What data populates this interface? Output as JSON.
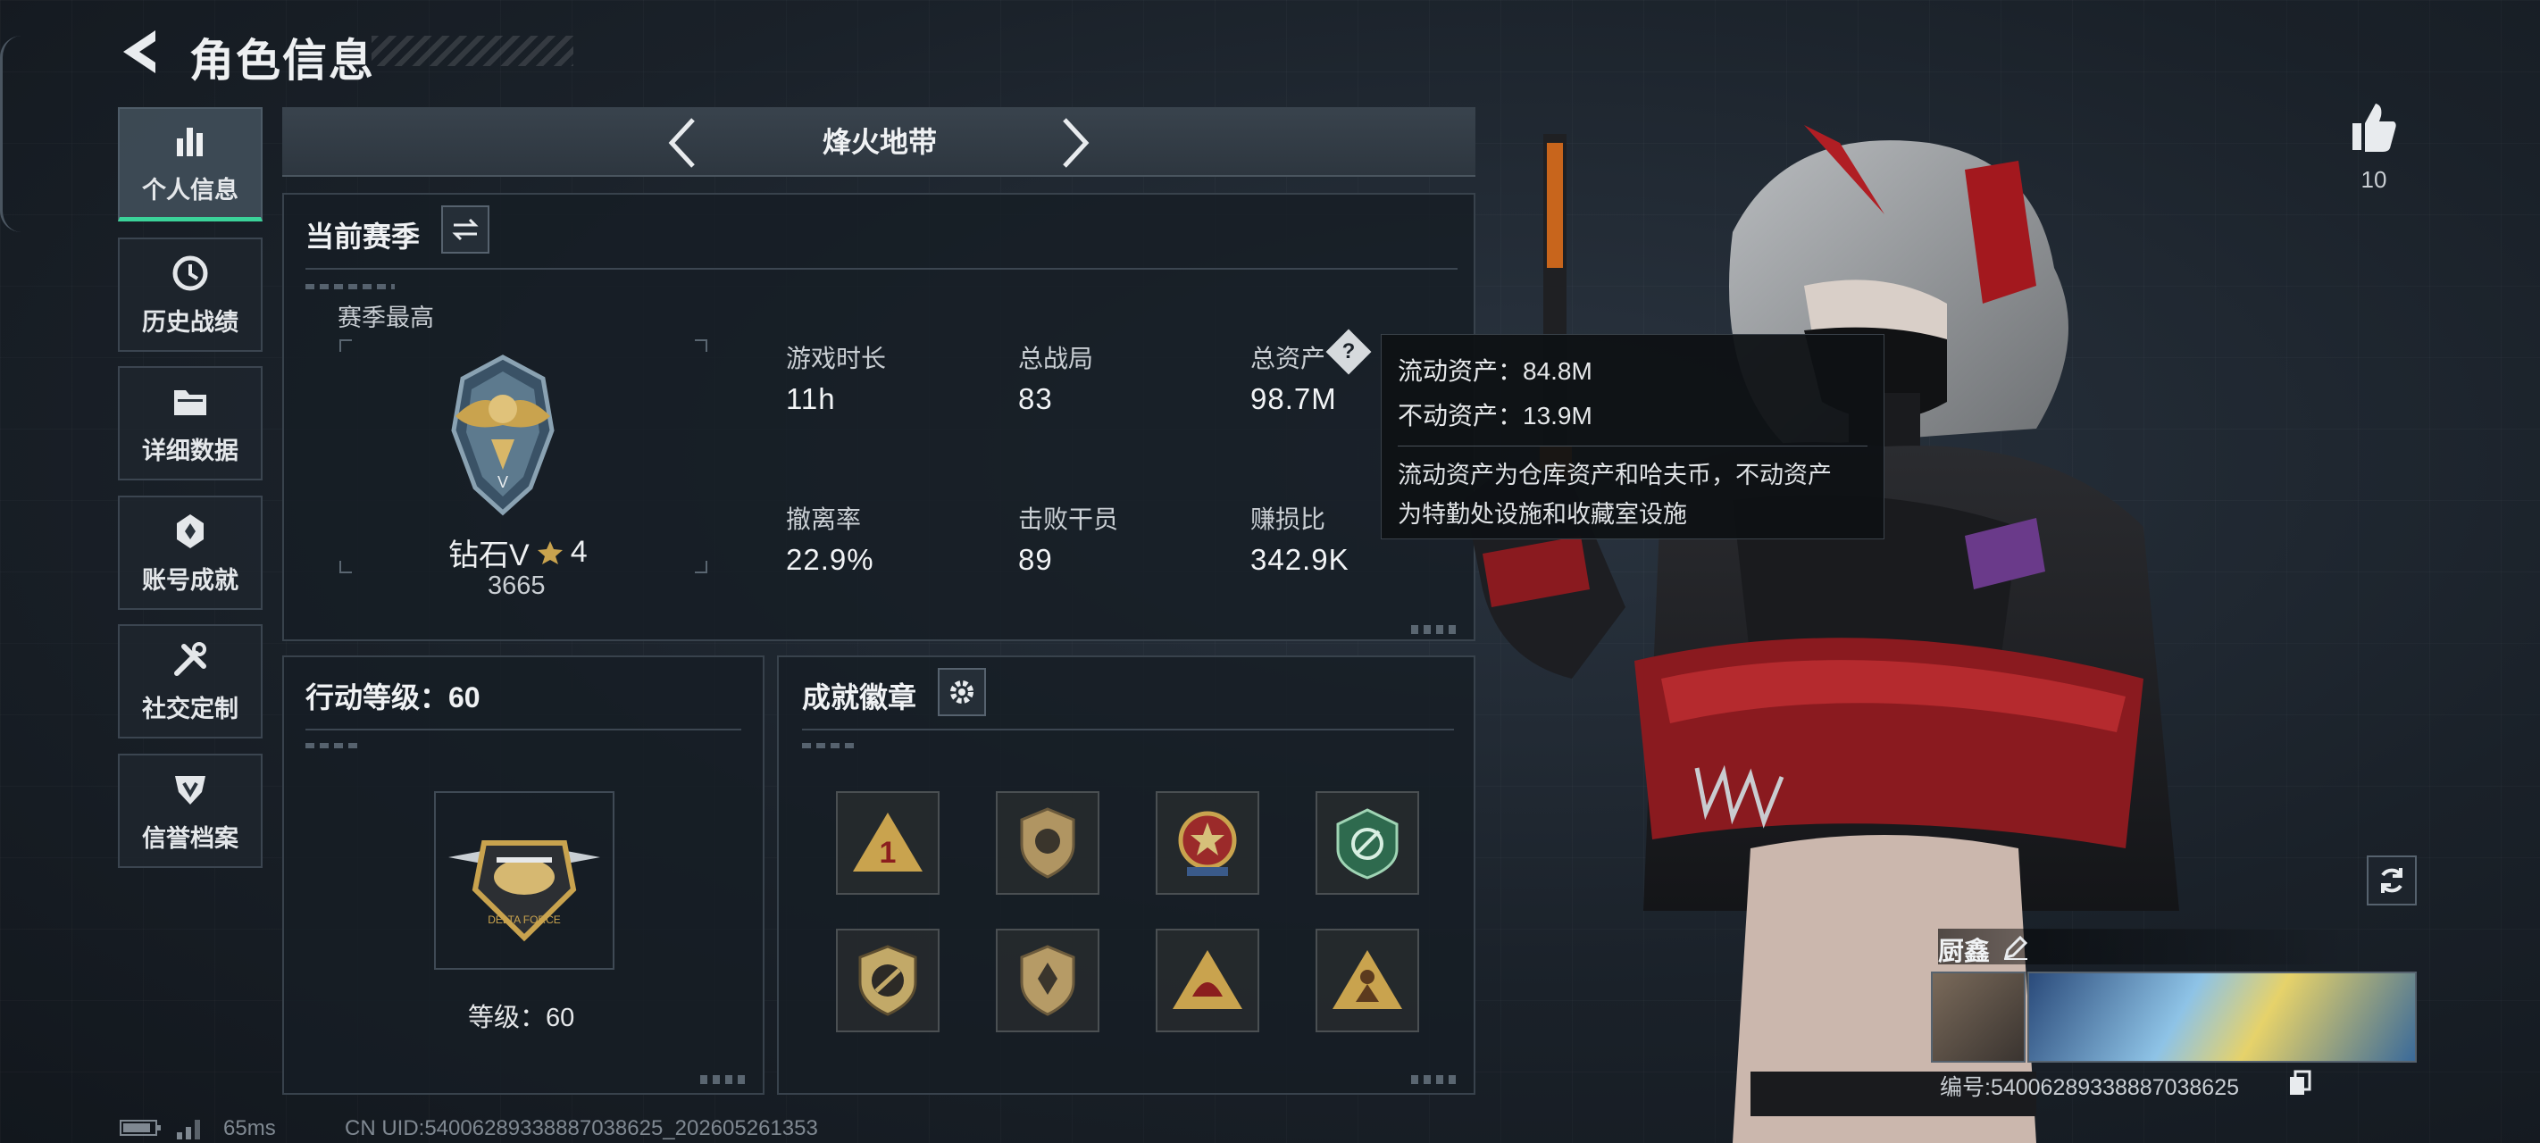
{
  "header": {
    "title": "角色信息"
  },
  "sidebar": {
    "items": [
      {
        "label": "个人信息",
        "icon": "bar-chart-icon",
        "active": true
      },
      {
        "label": "历史战绩",
        "icon": "history-icon"
      },
      {
        "label": "详细数据",
        "icon": "folder-icon"
      },
      {
        "label": "账号成就",
        "icon": "achievement-icon"
      },
      {
        "label": "社交定制",
        "icon": "tools-icon"
      },
      {
        "label": "信誉档案",
        "icon": "credit-icon"
      }
    ]
  },
  "mode": {
    "title": "烽火地带"
  },
  "season": {
    "title": "当前赛季",
    "best_label": "赛季最高",
    "rank_name": "钻石V",
    "rank_stars": "4",
    "rank_points": "3665",
    "stats": [
      {
        "label": "游戏时长",
        "value": "11h"
      },
      {
        "label": "总战局",
        "value": "83"
      },
      {
        "label": "总资产",
        "value": "98.7M"
      },
      {
        "label": "撤离率",
        "value": "22.9%"
      },
      {
        "label": "击败干员",
        "value": "89"
      },
      {
        "label": "赚损比",
        "value": "342.9K"
      }
    ]
  },
  "tooltip": {
    "liquid": "流动资产：84.8M",
    "fixed": "不动资产：13.9M",
    "desc_line1": "流动资产为仓库资产和哈夫币，不动资产",
    "desc_line2": "为特勤处设施和收藏室设施"
  },
  "action_level": {
    "title": "行动等级：60",
    "level_text": "等级：60"
  },
  "badges": {
    "title": "成就徽章",
    "items": [
      "badge-1",
      "badge-2",
      "badge-3",
      "badge-4",
      "badge-5",
      "badge-6",
      "badge-7",
      "badge-8"
    ]
  },
  "likes": {
    "count": "10"
  },
  "player": {
    "name": "厨鑫",
    "id_text": "编号:54006289338887038625"
  },
  "footer": {
    "ping": "65ms",
    "uid": "CN UID:54006289338887038625_202605261353"
  },
  "colors": {
    "accent": "#3bd39a",
    "gold": "#c9a34e"
  }
}
